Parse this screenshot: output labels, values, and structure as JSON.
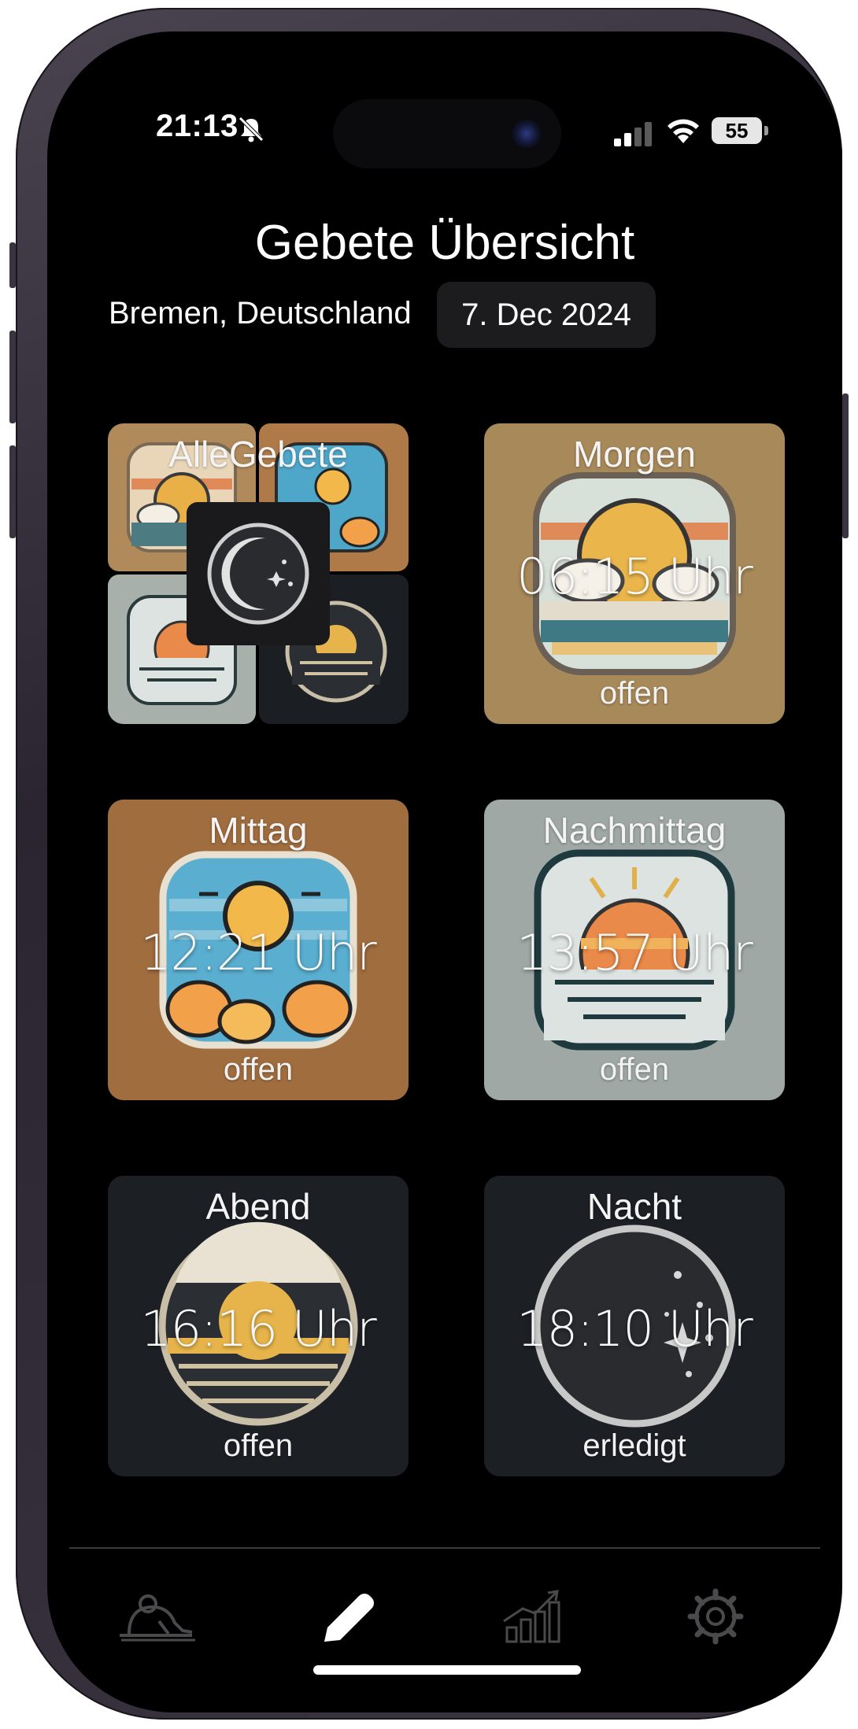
{
  "status_bar": {
    "time": "21:13",
    "battery": "55",
    "icons": [
      "bell-slash-icon",
      "cellular-signal-icon",
      "wifi-icon",
      "battery-icon"
    ]
  },
  "header": {
    "title": "Gebete Übersicht",
    "location": "Bremen, Deutschland",
    "date": "7. Dec 2024"
  },
  "cards": [
    {
      "title": "AlleGebete",
      "time": "",
      "status": ""
    },
    {
      "title": "Morgen",
      "time": "06:15 Uhr",
      "status": "offen"
    },
    {
      "title": "Mittag",
      "time": "12:21 Uhr",
      "status": "offen"
    },
    {
      "title": "Nachmittag",
      "time": "13:57 Uhr",
      "status": "offen"
    },
    {
      "title": "Abend",
      "time": "16:16 Uhr",
      "status": "offen"
    },
    {
      "title": "Nacht",
      "time": "18:10 Uhr",
      "status": "erledigt"
    }
  ],
  "tab_bar": {
    "tabs": [
      {
        "icon": "prayer-person-icon",
        "active": false
      },
      {
        "icon": "pencil-icon",
        "active": true
      },
      {
        "icon": "chart-growth-icon",
        "active": false
      },
      {
        "icon": "gear-icon",
        "active": false
      }
    ]
  },
  "colors": {
    "background": "#000000",
    "pill": "#1c1c1e",
    "morgen_card": "#a88a5a",
    "mittag_card": "#a06d3f",
    "nachmittag_card": "#9fa8a4",
    "abend_card": "#1c1f24",
    "nacht_card": "#1c1f24",
    "tab_inactive": "#4a4a4c",
    "tab_active": "#ffffff"
  }
}
